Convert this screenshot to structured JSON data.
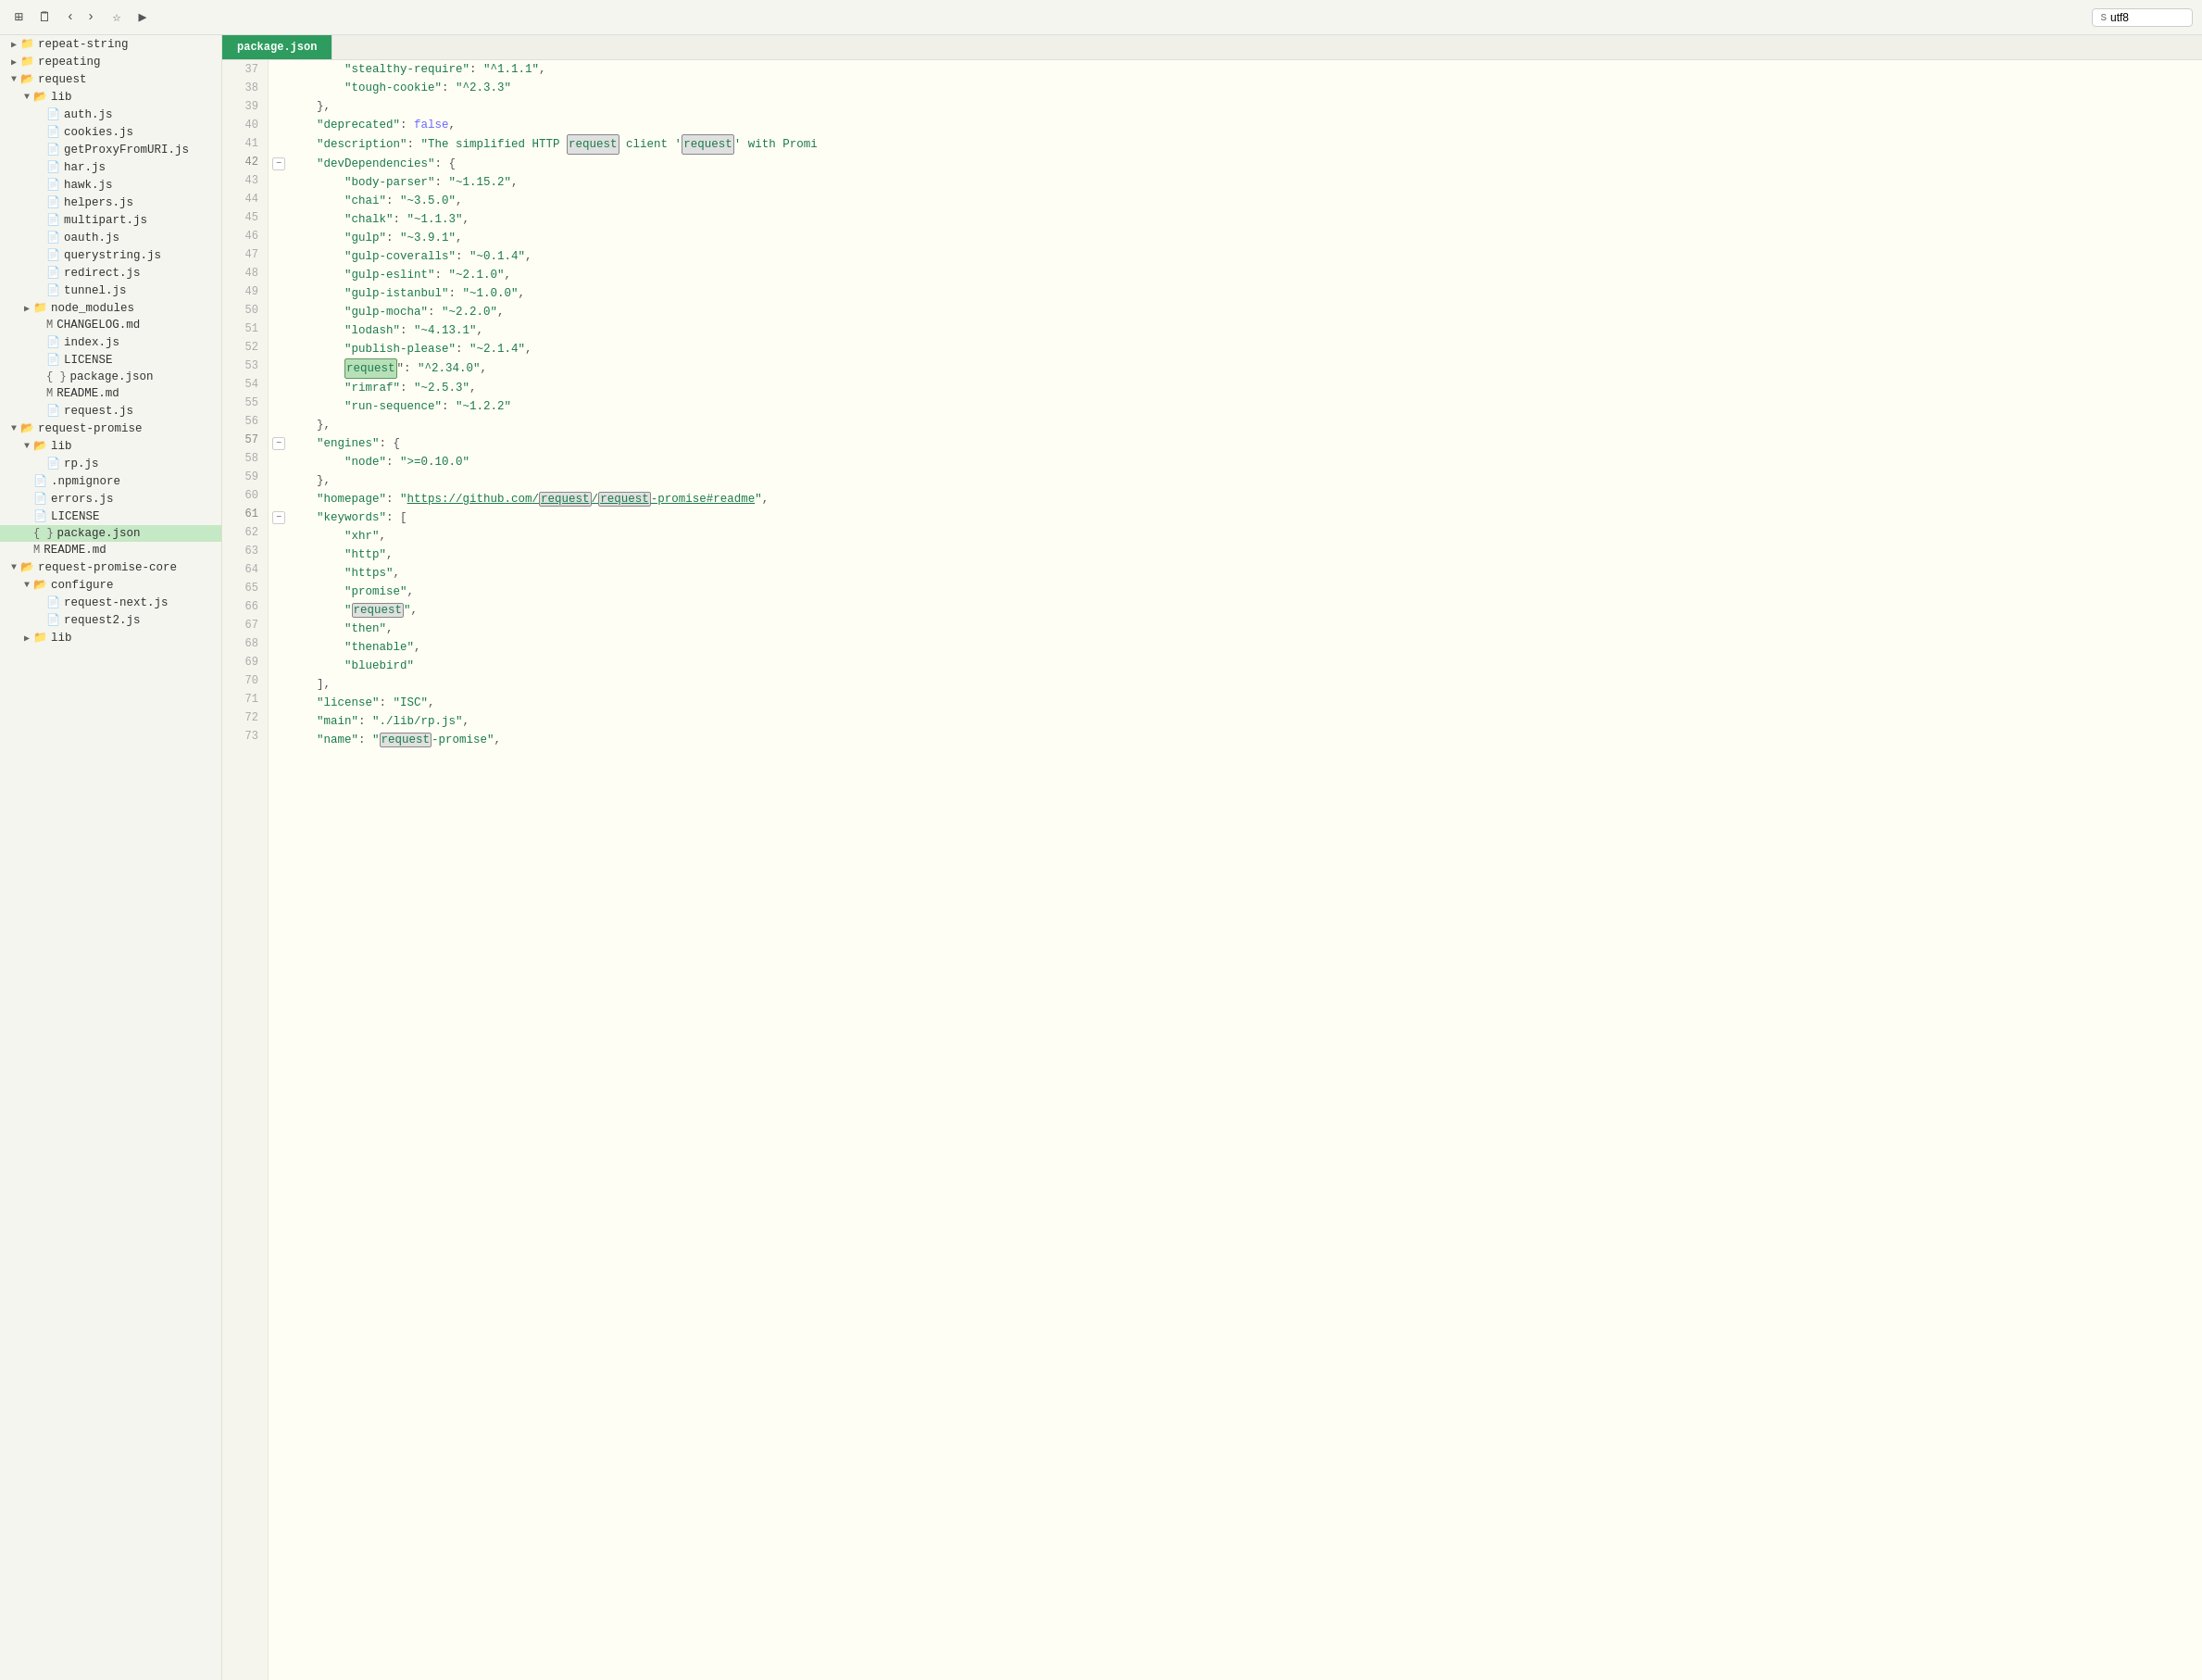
{
  "toolbar": {
    "search_placeholder": "utf8",
    "icons": [
      "grid-icon",
      "file-icon",
      "back-icon",
      "forward-icon",
      "star-icon",
      "play-icon"
    ]
  },
  "sidebar": {
    "items": [
      {
        "id": "repeat-string",
        "label": "repeat-string",
        "type": "folder",
        "indent": 0,
        "expanded": false
      },
      {
        "id": "repeating",
        "label": "repeating",
        "type": "folder",
        "indent": 0,
        "expanded": false
      },
      {
        "id": "request",
        "label": "request",
        "type": "folder",
        "indent": 0,
        "expanded": true
      },
      {
        "id": "lib",
        "label": "lib",
        "type": "folder",
        "indent": 1,
        "expanded": true
      },
      {
        "id": "auth.js",
        "label": "auth.js",
        "type": "js",
        "indent": 2
      },
      {
        "id": "cookies.js",
        "label": "cookies.js",
        "type": "js",
        "indent": 2
      },
      {
        "id": "getProxyFromURI.js",
        "label": "getProxyFromURI.js",
        "type": "js",
        "indent": 2
      },
      {
        "id": "har.js",
        "label": "har.js",
        "type": "js",
        "indent": 2
      },
      {
        "id": "hawk.js",
        "label": "hawk.js",
        "type": "js",
        "indent": 2
      },
      {
        "id": "helpers.js",
        "label": "helpers.js",
        "type": "js",
        "indent": 2
      },
      {
        "id": "multipart.js",
        "label": "multipart.js",
        "type": "js",
        "indent": 2
      },
      {
        "id": "oauth.js",
        "label": "oauth.js",
        "type": "js",
        "indent": 2
      },
      {
        "id": "querystring.js",
        "label": "querystring.js",
        "type": "js",
        "indent": 2
      },
      {
        "id": "redirect.js",
        "label": "redirect.js",
        "type": "js",
        "indent": 2
      },
      {
        "id": "tunnel.js",
        "label": "tunnel.js",
        "type": "js",
        "indent": 2
      },
      {
        "id": "node_modules",
        "label": "node_modules",
        "type": "folder",
        "indent": 1,
        "expanded": false
      },
      {
        "id": "CHANGELOG.md",
        "label": "CHANGELOG.md",
        "type": "md",
        "indent": 1
      },
      {
        "id": "index.js",
        "label": "index.js",
        "type": "js",
        "indent": 1
      },
      {
        "id": "LICENSE",
        "label": "LICENSE",
        "type": "license",
        "indent": 1
      },
      {
        "id": "package.json-req",
        "label": "package.json",
        "type": "json",
        "indent": 1
      },
      {
        "id": "README.md",
        "label": "README.md",
        "type": "md",
        "indent": 1
      },
      {
        "id": "request.js",
        "label": "request.js",
        "type": "js",
        "indent": 1
      },
      {
        "id": "request-promise",
        "label": "request-promise",
        "type": "folder",
        "indent": 0,
        "expanded": true
      },
      {
        "id": "lib2",
        "label": "lib",
        "type": "folder",
        "indent": 1,
        "expanded": true
      },
      {
        "id": "rp.js",
        "label": "rp.js",
        "type": "js",
        "indent": 2
      },
      {
        "id": ".npmignore",
        "label": ".npmignore",
        "type": "config",
        "indent": 1
      },
      {
        "id": "errors.js",
        "label": "errors.js",
        "type": "js",
        "indent": 1
      },
      {
        "id": "LICENSE2",
        "label": "LICENSE",
        "type": "license",
        "indent": 1
      },
      {
        "id": "package.json-rp",
        "label": "package.json",
        "type": "json",
        "indent": 1,
        "active": true
      },
      {
        "id": "README.md2",
        "label": "README.md",
        "type": "md",
        "indent": 1
      },
      {
        "id": "request-promise-core",
        "label": "request-promise-core",
        "type": "folder",
        "indent": 0,
        "expanded": true
      },
      {
        "id": "configure",
        "label": "configure",
        "type": "folder",
        "indent": 1,
        "expanded": true
      },
      {
        "id": "request-next.js",
        "label": "request-next.js",
        "type": "js",
        "indent": 2
      },
      {
        "id": "request2.js",
        "label": "request2.js",
        "type": "js",
        "indent": 2
      },
      {
        "id": "lib3",
        "label": "lib",
        "type": "folder",
        "indent": 1,
        "expanded": false
      }
    ]
  },
  "file_tab": {
    "label": "package.json"
  },
  "code": {
    "lines": [
      {
        "num": 37,
        "fold": false,
        "content": "    \"stealthy-require\": \"^1.1.1\","
      },
      {
        "num": 38,
        "fold": false,
        "content": "    \"tough-cookie\": \"^2.3.3\""
      },
      {
        "num": 39,
        "fold": false,
        "content": "  },"
      },
      {
        "num": 40,
        "fold": false,
        "content": "  \"deprecated\": false,"
      },
      {
        "num": 41,
        "fold": false,
        "content": "  \"description\": \"The simplified HTTP request client 'request' with Promi"
      },
      {
        "num": 42,
        "fold": true,
        "content": "  \"devDependencies\": {"
      },
      {
        "num": 43,
        "fold": false,
        "content": "    \"body-parser\": \"~1.15.2\","
      },
      {
        "num": 44,
        "fold": false,
        "content": "    \"chai\": \"~3.5.0\","
      },
      {
        "num": 45,
        "fold": false,
        "content": "    \"chalk\": \"~1.1.3\","
      },
      {
        "num": 46,
        "fold": false,
        "content": "    \"gulp\": \"~3.9.1\","
      },
      {
        "num": 47,
        "fold": false,
        "content": "    \"gulp-coveralls\": \"~0.1.4\","
      },
      {
        "num": 48,
        "fold": false,
        "content": "    \"gulp-eslint\": \"~2.1.0\","
      },
      {
        "num": 49,
        "fold": false,
        "content": "    \"gulp-istanbul\": \"~1.0.0\","
      },
      {
        "num": 50,
        "fold": false,
        "content": "    \"gulp-mocha\": \"~2.2.0\","
      },
      {
        "num": 51,
        "fold": false,
        "content": "    \"lodash\": \"~4.13.1\","
      },
      {
        "num": 52,
        "fold": false,
        "content": "    \"publish-please\": \"~2.1.4\","
      },
      {
        "num": 53,
        "fold": false,
        "content": "    \"request\": \"^2.34.0\","
      },
      {
        "num": 54,
        "fold": false,
        "content": "    \"rimraf\": \"~2.5.3\","
      },
      {
        "num": 55,
        "fold": false,
        "content": "    \"run-sequence\": \"~1.2.2\""
      },
      {
        "num": 56,
        "fold": false,
        "content": "  },"
      },
      {
        "num": 57,
        "fold": true,
        "content": "  \"engines\": {"
      },
      {
        "num": 58,
        "fold": false,
        "content": "    \"node\": \">=0.10.0\""
      },
      {
        "num": 59,
        "fold": false,
        "content": "  },"
      },
      {
        "num": 60,
        "fold": false,
        "content": "  \"homepage\": \"https://github.com/request/request-promise#readme\","
      },
      {
        "num": 61,
        "fold": true,
        "content": "  \"keywords\": ["
      },
      {
        "num": 62,
        "fold": false,
        "content": "    \"xhr\","
      },
      {
        "num": 63,
        "fold": false,
        "content": "    \"http\","
      },
      {
        "num": 64,
        "fold": false,
        "content": "    \"https\","
      },
      {
        "num": 65,
        "fold": false,
        "content": "    \"promise\","
      },
      {
        "num": 66,
        "fold": false,
        "content": "    \"request\","
      },
      {
        "num": 67,
        "fold": false,
        "content": "    \"then\","
      },
      {
        "num": 68,
        "fold": false,
        "content": "    \"thenable\","
      },
      {
        "num": 69,
        "fold": false,
        "content": "    \"bluebird\""
      },
      {
        "num": 70,
        "fold": false,
        "content": "  ],"
      },
      {
        "num": 71,
        "fold": false,
        "content": "  \"license\": \"ISC\","
      },
      {
        "num": 72,
        "fold": false,
        "content": "  \"main\": \"./lib/rp.js\","
      },
      {
        "num": 73,
        "fold": false,
        "content": "  \"name\": \"request-promise\","
      }
    ]
  }
}
